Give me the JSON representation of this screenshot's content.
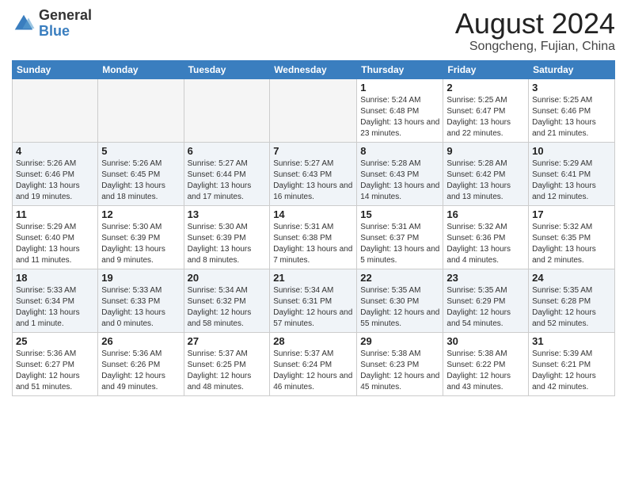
{
  "logo": {
    "general": "General",
    "blue": "Blue"
  },
  "title": "August 2024",
  "location": "Songcheng, Fujian, China",
  "days_of_week": [
    "Sunday",
    "Monday",
    "Tuesday",
    "Wednesday",
    "Thursday",
    "Friday",
    "Saturday"
  ],
  "weeks": [
    [
      {
        "num": "",
        "info": ""
      },
      {
        "num": "",
        "info": ""
      },
      {
        "num": "",
        "info": ""
      },
      {
        "num": "",
        "info": ""
      },
      {
        "num": "1",
        "info": "Sunrise: 5:24 AM\nSunset: 6:48 PM\nDaylight: 13 hours\nand 23 minutes."
      },
      {
        "num": "2",
        "info": "Sunrise: 5:25 AM\nSunset: 6:47 PM\nDaylight: 13 hours\nand 22 minutes."
      },
      {
        "num": "3",
        "info": "Sunrise: 5:25 AM\nSunset: 6:46 PM\nDaylight: 13 hours\nand 21 minutes."
      }
    ],
    [
      {
        "num": "4",
        "info": "Sunrise: 5:26 AM\nSunset: 6:46 PM\nDaylight: 13 hours\nand 19 minutes."
      },
      {
        "num": "5",
        "info": "Sunrise: 5:26 AM\nSunset: 6:45 PM\nDaylight: 13 hours\nand 18 minutes."
      },
      {
        "num": "6",
        "info": "Sunrise: 5:27 AM\nSunset: 6:44 PM\nDaylight: 13 hours\nand 17 minutes."
      },
      {
        "num": "7",
        "info": "Sunrise: 5:27 AM\nSunset: 6:43 PM\nDaylight: 13 hours\nand 16 minutes."
      },
      {
        "num": "8",
        "info": "Sunrise: 5:28 AM\nSunset: 6:43 PM\nDaylight: 13 hours\nand 14 minutes."
      },
      {
        "num": "9",
        "info": "Sunrise: 5:28 AM\nSunset: 6:42 PM\nDaylight: 13 hours\nand 13 minutes."
      },
      {
        "num": "10",
        "info": "Sunrise: 5:29 AM\nSunset: 6:41 PM\nDaylight: 13 hours\nand 12 minutes."
      }
    ],
    [
      {
        "num": "11",
        "info": "Sunrise: 5:29 AM\nSunset: 6:40 PM\nDaylight: 13 hours\nand 11 minutes."
      },
      {
        "num": "12",
        "info": "Sunrise: 5:30 AM\nSunset: 6:39 PM\nDaylight: 13 hours\nand 9 minutes."
      },
      {
        "num": "13",
        "info": "Sunrise: 5:30 AM\nSunset: 6:39 PM\nDaylight: 13 hours\nand 8 minutes."
      },
      {
        "num": "14",
        "info": "Sunrise: 5:31 AM\nSunset: 6:38 PM\nDaylight: 13 hours\nand 7 minutes."
      },
      {
        "num": "15",
        "info": "Sunrise: 5:31 AM\nSunset: 6:37 PM\nDaylight: 13 hours\nand 5 minutes."
      },
      {
        "num": "16",
        "info": "Sunrise: 5:32 AM\nSunset: 6:36 PM\nDaylight: 13 hours\nand 4 minutes."
      },
      {
        "num": "17",
        "info": "Sunrise: 5:32 AM\nSunset: 6:35 PM\nDaylight: 13 hours\nand 2 minutes."
      }
    ],
    [
      {
        "num": "18",
        "info": "Sunrise: 5:33 AM\nSunset: 6:34 PM\nDaylight: 13 hours\nand 1 minute."
      },
      {
        "num": "19",
        "info": "Sunrise: 5:33 AM\nSunset: 6:33 PM\nDaylight: 13 hours\nand 0 minutes."
      },
      {
        "num": "20",
        "info": "Sunrise: 5:34 AM\nSunset: 6:32 PM\nDaylight: 12 hours\nand 58 minutes."
      },
      {
        "num": "21",
        "info": "Sunrise: 5:34 AM\nSunset: 6:31 PM\nDaylight: 12 hours\nand 57 minutes."
      },
      {
        "num": "22",
        "info": "Sunrise: 5:35 AM\nSunset: 6:30 PM\nDaylight: 12 hours\nand 55 minutes."
      },
      {
        "num": "23",
        "info": "Sunrise: 5:35 AM\nSunset: 6:29 PM\nDaylight: 12 hours\nand 54 minutes."
      },
      {
        "num": "24",
        "info": "Sunrise: 5:35 AM\nSunset: 6:28 PM\nDaylight: 12 hours\nand 52 minutes."
      }
    ],
    [
      {
        "num": "25",
        "info": "Sunrise: 5:36 AM\nSunset: 6:27 PM\nDaylight: 12 hours\nand 51 minutes."
      },
      {
        "num": "26",
        "info": "Sunrise: 5:36 AM\nSunset: 6:26 PM\nDaylight: 12 hours\nand 49 minutes."
      },
      {
        "num": "27",
        "info": "Sunrise: 5:37 AM\nSunset: 6:25 PM\nDaylight: 12 hours\nand 48 minutes."
      },
      {
        "num": "28",
        "info": "Sunrise: 5:37 AM\nSunset: 6:24 PM\nDaylight: 12 hours\nand 46 minutes."
      },
      {
        "num": "29",
        "info": "Sunrise: 5:38 AM\nSunset: 6:23 PM\nDaylight: 12 hours\nand 45 minutes."
      },
      {
        "num": "30",
        "info": "Sunrise: 5:38 AM\nSunset: 6:22 PM\nDaylight: 12 hours\nand 43 minutes."
      },
      {
        "num": "31",
        "info": "Sunrise: 5:39 AM\nSunset: 6:21 PM\nDaylight: 12 hours\nand 42 minutes."
      }
    ]
  ]
}
